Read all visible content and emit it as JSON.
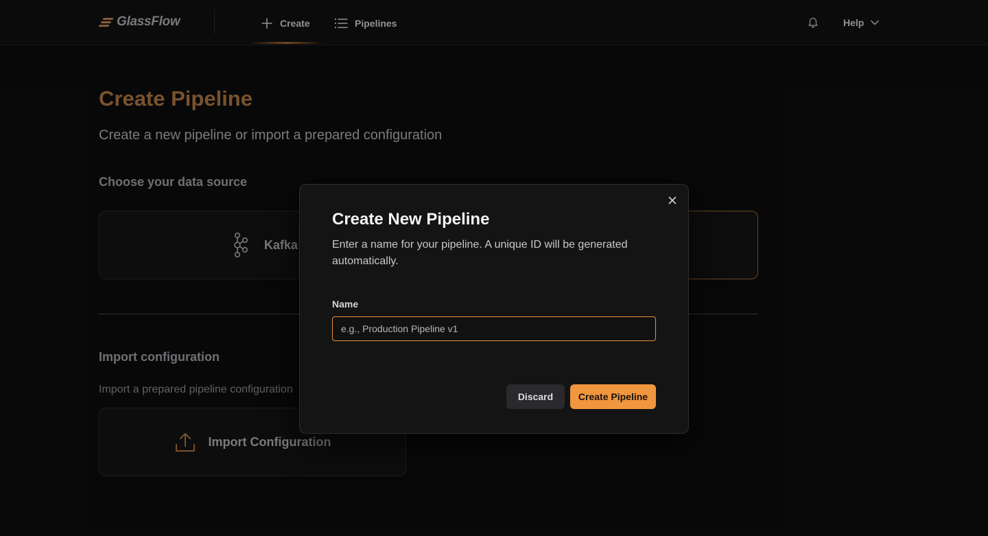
{
  "app": {
    "brand": "GlassFlow"
  },
  "nav": {
    "create_label": "Create",
    "pipelines_label": "Pipelines",
    "help_label": "Help"
  },
  "page": {
    "title": "Create Pipeline",
    "subtitle": "Create a new pipeline or import a prepared configuration",
    "data_source_heading": "Choose your data source",
    "sources": [
      {
        "label": "Kafka",
        "icon": "kafka-icon"
      }
    ],
    "import_heading": "Import configuration",
    "import_description": "Import a prepared pipeline configuration",
    "import_button_label": "Import Configuration"
  },
  "modal": {
    "title": "Create New Pipeline",
    "description": "Enter a name for your pipeline. A unique ID will be generated automatically.",
    "name_label": "Name",
    "name_value": "",
    "name_placeholder": "e.g., Production Pipeline v1",
    "discard_label": "Discard",
    "create_label": "Create Pipeline"
  },
  "colors": {
    "accent": "#f0963e",
    "accent_dim": "#8a5e35",
    "background": "#0a0a0b",
    "modal_bg": "#141415"
  },
  "icons": [
    "plus-icon",
    "list-icon",
    "bell-icon",
    "chevron-down-icon",
    "close-icon",
    "kafka-icon",
    "upload-icon"
  ]
}
